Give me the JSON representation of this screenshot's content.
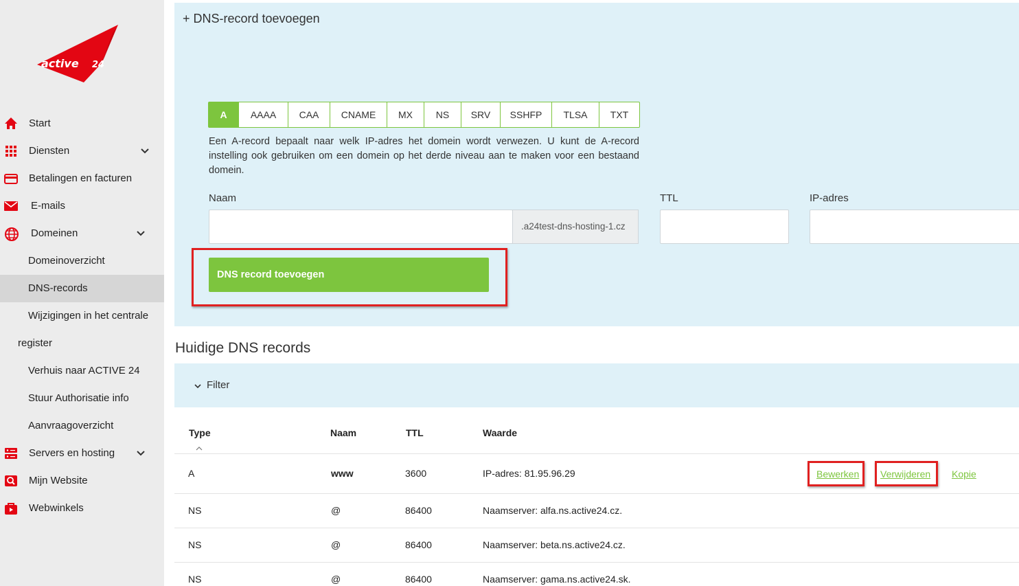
{
  "brand": {
    "logo_text": "active24",
    "accent": "#e30613",
    "green": "#7dc53e"
  },
  "sidebar": {
    "items": [
      {
        "label": "Start",
        "icon": "home-icon"
      },
      {
        "label": "Diensten",
        "icon": "grid-icon"
      },
      {
        "label": "Betalingen en facturen",
        "icon": "credit-card-icon"
      },
      {
        "label": "E-mails",
        "icon": "envelope-icon"
      },
      {
        "label": "Domeinen",
        "icon": "globe-icon"
      },
      {
        "label": "Servers en hosting",
        "icon": "server-icon"
      },
      {
        "label": "Mijn Website",
        "icon": "website-search-icon"
      },
      {
        "label": "Webwinkels",
        "icon": "shop-bag-icon"
      }
    ],
    "domain_sub": [
      {
        "label": "Domeinoverzicht"
      },
      {
        "label": "DNS-records"
      },
      {
        "label": "Wijzigingen in het centrale"
      },
      {
        "label": "register"
      },
      {
        "label": "Verhuis naar ACTIVE 24"
      },
      {
        "label": "Stuur Authorisatie info"
      },
      {
        "label": "Aanvraagoverzicht"
      }
    ]
  },
  "add_panel": {
    "title": "+ DNS-record toevoegen",
    "tabs": [
      "A",
      "AAAA",
      "CAA",
      "CNAME",
      "MX",
      "NS",
      "SRV",
      "SSHFP",
      "TLSA",
      "TXT"
    ],
    "active_tab": "A",
    "description": "Een A-record bepaalt naar welk IP-adres het domein wordt verwezen. U kunt de A-record instelling ook gebruiken om een domein op het derde niveau aan te maken voor een bestaand domein.",
    "name_label": "Naam",
    "name_value": "",
    "name_suffix": ".a24test-dns-hosting-1.cz",
    "ttl_label": "TTL",
    "ttl_value": "",
    "ip_label": "IP-adres",
    "ip_value": "",
    "submit_label": "DNS record toevoegen"
  },
  "records": {
    "title": "Huidige DNS records",
    "filter_label": "Filter",
    "columns": {
      "type": "Type",
      "name": "Naam",
      "ttl": "TTL",
      "value": "Waarde"
    },
    "rows": [
      {
        "type": "A",
        "name": "www",
        "ttl": "3600",
        "value": "IP-adres: 81.95.96.29"
      },
      {
        "type": "NS",
        "name": "@",
        "ttl": "86400",
        "value": "Naamserver: alfa.ns.active24.cz."
      },
      {
        "type": "NS",
        "name": "@",
        "ttl": "86400",
        "value": "Naamserver: beta.ns.active24.cz."
      },
      {
        "type": "NS",
        "name": "@",
        "ttl": "86400",
        "value": "Naamserver: gama.ns.active24.sk."
      }
    ],
    "actions": {
      "edit": "Bewerken",
      "delete": "Verwijderen",
      "copy": "Kopie"
    }
  }
}
